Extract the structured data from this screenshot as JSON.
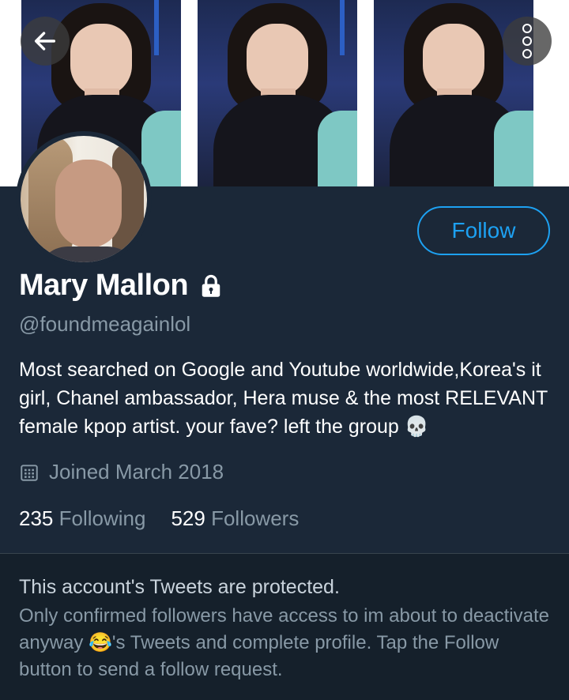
{
  "header": {
    "back_icon": "arrow-left-icon",
    "more_icon": "more-vertical-icon"
  },
  "profile": {
    "name": "Mary Mallon",
    "handle": "@foundmeagainlol",
    "bio": "Most searched on Google and Youtube worldwide,Korea's it girl, Chanel ambassador, Hera muse & the most RELEVANT female kpop artist. your fave? left the group 💀",
    "joined": "Joined March 2018",
    "following_count": "235",
    "following_label": "Following",
    "followers_count": "529",
    "followers_label": "Followers",
    "follow_button": "Follow"
  },
  "protected": {
    "title": "This account's Tweets are protected.",
    "body": "Only confirmed followers have access to im about to deactivate anyway 😂's Tweets and complete profile. Tap the Follow button to send a follow request."
  },
  "colors": {
    "background": "#1b2838",
    "accent": "#1da1f2",
    "secondary_text": "#8899a6"
  }
}
